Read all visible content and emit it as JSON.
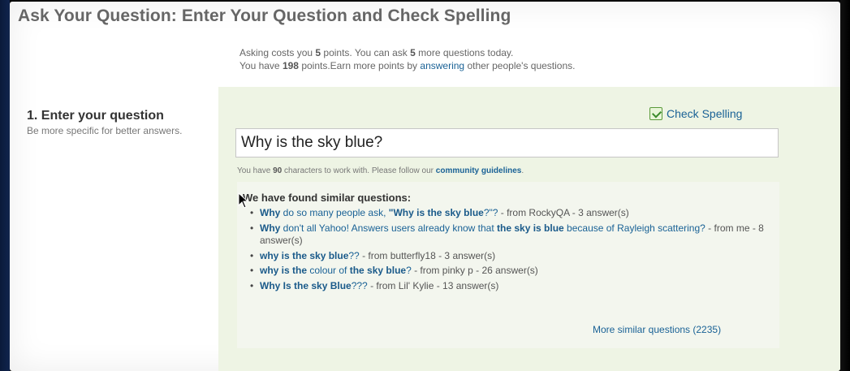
{
  "title": "Ask Your Question: Enter Your Question and Check Spelling",
  "info": {
    "line1_prefix": "Asking costs you ",
    "cost_points": "5",
    "line1_mid": " points. You can ask ",
    "questions_left": "5",
    "line1_suffix": " more questions today.",
    "line2_prefix": "You have ",
    "total_points": "198",
    "line2_mid": " points.Earn more points by ",
    "answering_link": "answering",
    "line2_suffix": " other people's questions."
  },
  "step": {
    "label": "1. Enter your question",
    "help": "Be more specific for better answers."
  },
  "check_spelling": {
    "label": "Check Spelling",
    "icon": "spellcheck-icon"
  },
  "question_input": {
    "value": "Why is the sky blue?"
  },
  "char_note": {
    "prefix": "You have ",
    "count": "90",
    "mid": " characters to work with. Please follow our ",
    "link": "community guidelines",
    "suffix": "."
  },
  "similar": {
    "heading": "We have found similar questions:",
    "items": [
      {
        "parts": [
          {
            "text": "Why",
            "bold": true
          },
          {
            "text": " do so many people ask, ",
            "bold": false
          },
          {
            "text": "\"Why is the sky blue",
            "bold": true
          },
          {
            "text": "?\"?",
            "bold": false
          }
        ],
        "meta": " - from RockyQA - 3 answer(s)"
      },
      {
        "parts": [
          {
            "text": "Why",
            "bold": true
          },
          {
            "text": " don't all Yahoo! Answers users already know that ",
            "bold": false
          },
          {
            "text": "the sky is blue",
            "bold": true
          },
          {
            "text": " because of Rayleigh scattering?",
            "bold": false
          }
        ],
        "meta": " - from me - 8 answer(s)"
      },
      {
        "parts": [
          {
            "text": "why is the sky blue",
            "bold": true
          },
          {
            "text": "??",
            "bold": false
          }
        ],
        "meta": " - from butterfly18 - 3 answer(s)"
      },
      {
        "parts": [
          {
            "text": "why is the",
            "bold": true
          },
          {
            "text": " colour of ",
            "bold": false
          },
          {
            "text": "the sky blue",
            "bold": true
          },
          {
            "text": "?",
            "bold": false
          }
        ],
        "meta": " - from pinky p - 26 answer(s)"
      },
      {
        "parts": [
          {
            "text": "Why Is the sky Blue",
            "bold": true
          },
          {
            "text": "???",
            "bold": false
          }
        ],
        "meta": " - from Lil' Kylie - 13 answer(s)"
      }
    ],
    "more_link": "More similar questions (2235)"
  },
  "colors": {
    "link": "#1a6296",
    "panel": "#eef4e4",
    "title": "#666666"
  }
}
